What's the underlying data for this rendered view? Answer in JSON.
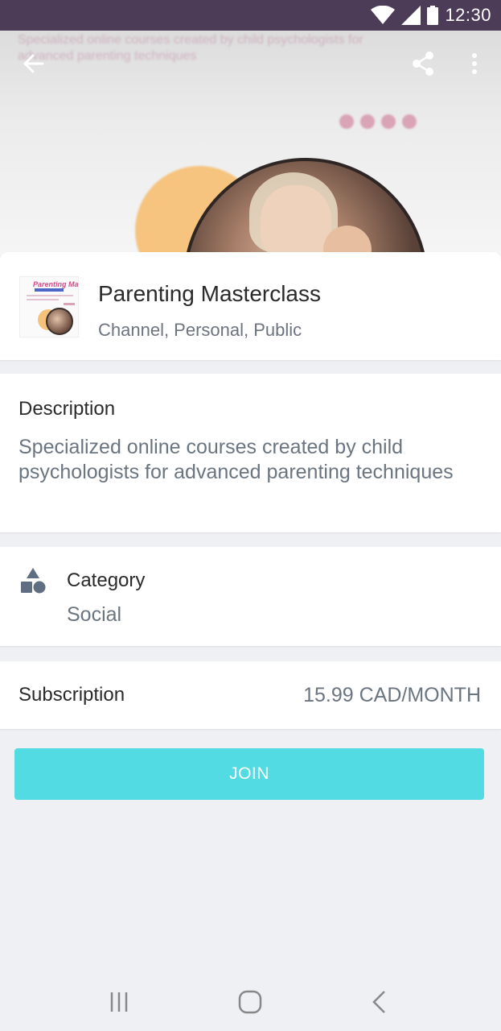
{
  "status_bar": {
    "time": "12:30"
  },
  "hero": {
    "overlay_text": "Specialized online courses created by child psychologists for advanced parenting techniques"
  },
  "toolbar": {
    "back_icon": "arrow-left",
    "share_icon": "share",
    "more_icon": "more-vertical"
  },
  "header": {
    "title": "Parenting Masterclass",
    "subtitle": "Channel, Personal, Public",
    "thumbnail_text": "Parenting Masterclass"
  },
  "description": {
    "label": "Description",
    "text": "Specialized online courses created by child psychologists for advanced parenting techniques"
  },
  "category": {
    "label": "Category",
    "value": "Social",
    "icon": "shapes"
  },
  "subscription": {
    "label": "Subscription",
    "value": "15.99 CAD/MONTH"
  },
  "join_button": {
    "label": "JOIN"
  },
  "colors": {
    "status_bar": "#4c3c58",
    "join_button": "#52dbe3",
    "background": "#eef0f4",
    "secondary_text": "#6a7580"
  }
}
